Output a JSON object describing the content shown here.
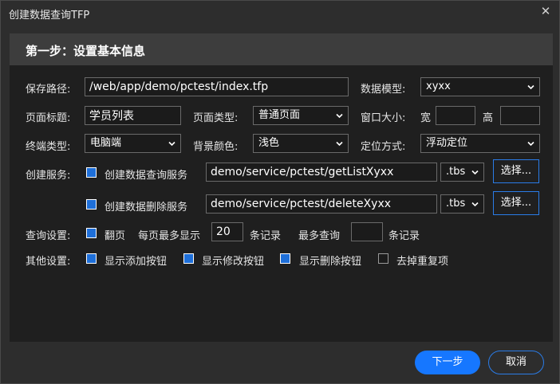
{
  "window": {
    "title": "创建数据查询TFP"
  },
  "header": {
    "title": "第一步：设置基本信息"
  },
  "form": {
    "save_path_label": "保存路径:",
    "save_path_value": "/web/app/demo/pctest/index.tfp",
    "data_model_label": "数据模型:",
    "data_model_value": "xyxx",
    "page_title_label": "页面标题:",
    "page_title_value": "学员列表",
    "page_type_label": "页面类型:",
    "page_type_value": "普通页面",
    "window_size_label": "窗口大小:",
    "width_label": "宽",
    "width_value": "",
    "height_label": "高",
    "height_value": "",
    "terminal_type_label": "终端类型:",
    "terminal_type_value": "电脑端",
    "bg_color_label": "背景颜色:",
    "bg_color_value": "浅色",
    "position_label": "定位方式:",
    "position_value": "浮动定位",
    "create_service_label": "创建服务:",
    "query_service_label": "创建数据查询服务",
    "query_service_path": "demo/service/pctest/getListXyxx",
    "query_service_ext": ".tbs",
    "delete_service_label": "创建数据删除服务",
    "delete_service_path": "demo/service/pctest/deleteXyxx",
    "delete_service_ext": ".tbs",
    "choose_label": "选择...",
    "query_settings_label": "查询设置:",
    "paging_label": "翻页",
    "per_page_label": "每页最多显示",
    "per_page_value": "20",
    "records_label": "条记录",
    "max_query_label": "最多查询",
    "max_query_value": "",
    "records_label2": "条记录",
    "other_settings_label": "其他设置:",
    "show_add_label": "显示添加按钮",
    "show_edit_label": "显示修改按钮",
    "show_delete_label": "显示删除按钮",
    "dedupe_label": "去掉重复项"
  },
  "footer": {
    "next_label": "下一步",
    "cancel_label": "取消"
  },
  "icons": {
    "close": "close-icon",
    "chevron": "chevron-down-icon"
  },
  "colors": {
    "accent": "#1677ff",
    "background": "#2d2d2d",
    "panel": "#1f1f1f"
  }
}
